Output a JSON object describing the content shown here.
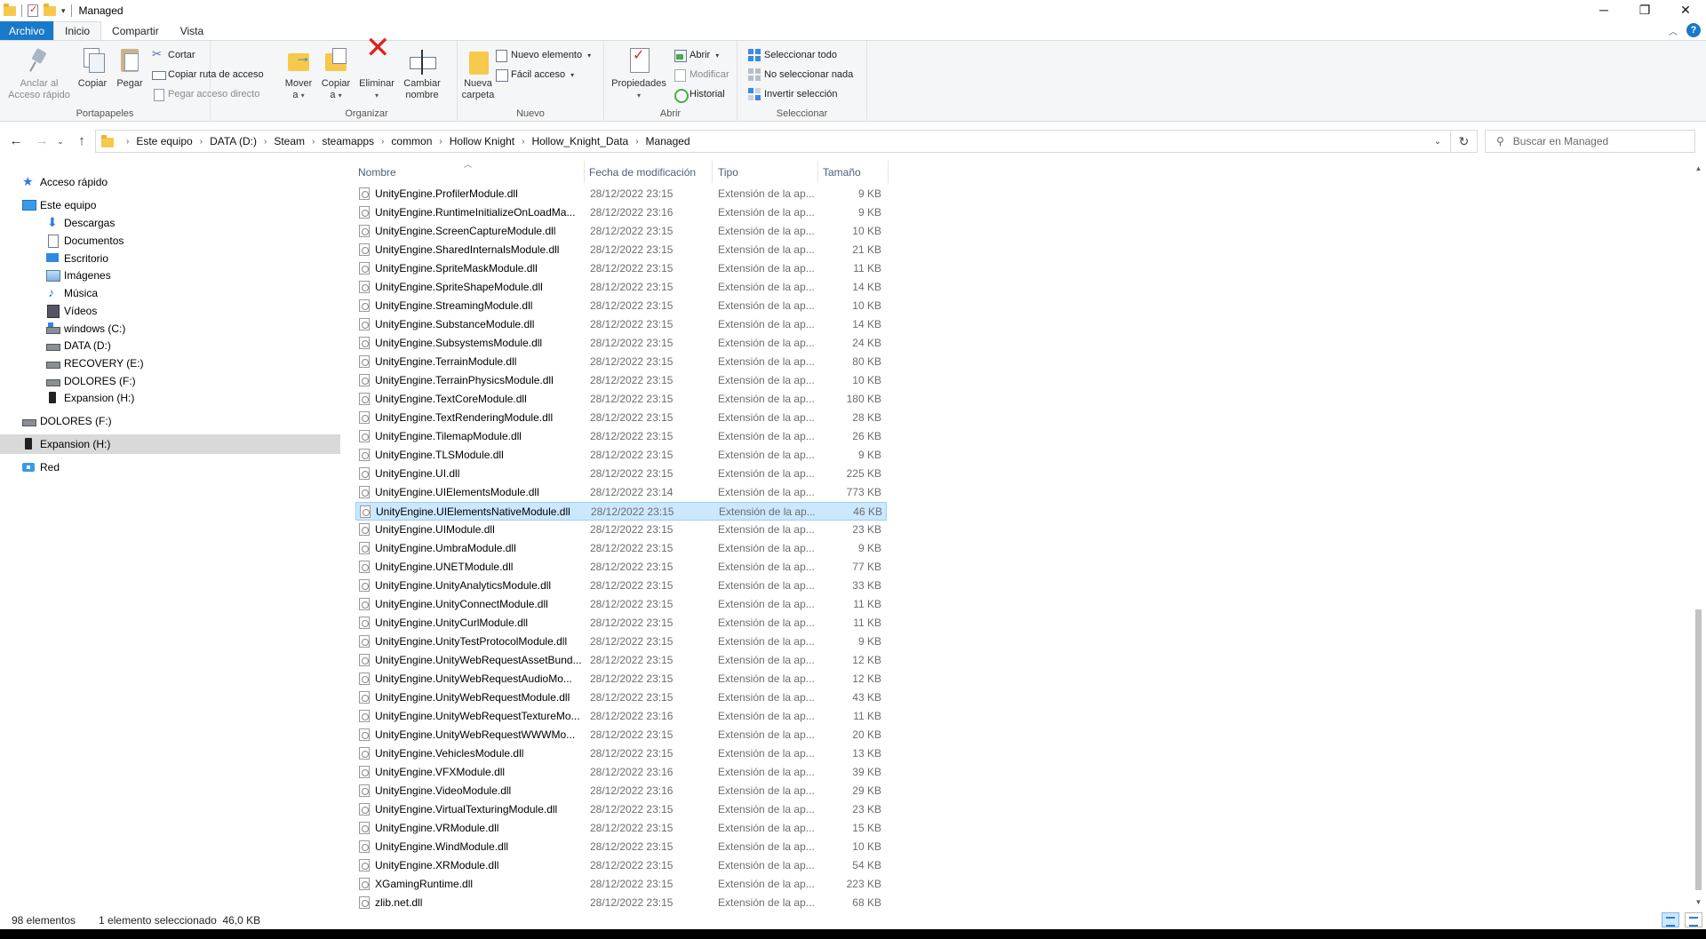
{
  "window": {
    "title": "Managed",
    "minimize_icon": "minimize-icon",
    "maximize_icon": "restore-icon",
    "close_icon": "close-icon"
  },
  "ribbon_tabs": {
    "file": "Archivo",
    "home": "Inicio",
    "share": "Compartir",
    "view": "Vista"
  },
  "ribbon": {
    "clipboard": {
      "label": "Portapapeles",
      "pin": "Anclar al Acceso rápido",
      "pin_l1": "Anclar al",
      "pin_l2": "Acceso rápido",
      "copy": "Copiar",
      "paste": "Pegar",
      "cut": "Cortar",
      "copy_path": "Copiar ruta de acceso",
      "paste_shortcut": "Pegar acceso directo"
    },
    "organize": {
      "label": "Organizar",
      "move_l1": "Mover",
      "move_l2": "a",
      "copy_l1": "Copiar",
      "copy_l2": "a",
      "delete": "Eliminar",
      "rename_l1": "Cambiar",
      "rename_l2": "nombre"
    },
    "new": {
      "label": "Nuevo",
      "folder_l1": "Nueva",
      "folder_l2": "carpeta",
      "new_item": "Nuevo elemento",
      "easy_access": "Fácil acceso"
    },
    "open": {
      "label": "Abrir",
      "properties": "Propiedades",
      "open": "Abrir",
      "edit": "Modificar",
      "history": "Historial"
    },
    "select": {
      "label": "Seleccionar",
      "select_all": "Seleccionar todo",
      "select_none": "No seleccionar nada",
      "invert": "Invertir selección"
    }
  },
  "address": {
    "breadcrumbs": [
      "Este equipo",
      "DATA (D:)",
      "Steam",
      "steamapps",
      "common",
      "Hollow Knight",
      "Hollow_Knight_Data",
      "Managed"
    ]
  },
  "search": {
    "placeholder": "Buscar en Managed"
  },
  "nav": {
    "items": [
      {
        "label": "Acceso rápido",
        "icon": "star-icon"
      },
      {
        "label": "Este equipo",
        "icon": "computer-icon"
      },
      {
        "label": "Descargas",
        "icon": "downloads-icon"
      },
      {
        "label": "Documentos",
        "icon": "documents-icon"
      },
      {
        "label": "Escritorio",
        "icon": "desktop-icon"
      },
      {
        "label": "Imágenes",
        "icon": "pictures-icon"
      },
      {
        "label": "Música",
        "icon": "music-icon"
      },
      {
        "label": "Vídeos",
        "icon": "videos-icon"
      },
      {
        "label": "windows (C:)",
        "icon": "windows-drive-icon"
      },
      {
        "label": "DATA (D:)",
        "icon": "drive-icon"
      },
      {
        "label": "RECOVERY (E:)",
        "icon": "drive-icon"
      },
      {
        "label": "DOLORES (F:)",
        "icon": "drive-icon"
      },
      {
        "label": "Expansion (H:)",
        "icon": "usb-drive-icon"
      },
      {
        "label": "DOLORES (F:)",
        "icon": "drive-icon"
      },
      {
        "label": "Expansion (H:)",
        "icon": "usb-drive-icon"
      },
      {
        "label": "Red",
        "icon": "network-icon"
      }
    ]
  },
  "columns": {
    "name": "Nombre",
    "date": "Fecha de modificación",
    "type": "Tipo",
    "size": "Tamaño"
  },
  "files": [
    {
      "name": "UnityEngine.ProfilerModule.dll",
      "date": "28/12/2022 23:15",
      "type": "Extensión de la ap...",
      "size": "9 KB"
    },
    {
      "name": "UnityEngine.RuntimeInitializeOnLoadMa...",
      "date": "28/12/2022 23:16",
      "type": "Extensión de la ap...",
      "size": "9 KB"
    },
    {
      "name": "UnityEngine.ScreenCaptureModule.dll",
      "date": "28/12/2022 23:15",
      "type": "Extensión de la ap...",
      "size": "10 KB"
    },
    {
      "name": "UnityEngine.SharedInternalsModule.dll",
      "date": "28/12/2022 23:15",
      "type": "Extensión de la ap...",
      "size": "21 KB"
    },
    {
      "name": "UnityEngine.SpriteMaskModule.dll",
      "date": "28/12/2022 23:15",
      "type": "Extensión de la ap...",
      "size": "11 KB"
    },
    {
      "name": "UnityEngine.SpriteShapeModule.dll",
      "date": "28/12/2022 23:15",
      "type": "Extensión de la ap...",
      "size": "14 KB"
    },
    {
      "name": "UnityEngine.StreamingModule.dll",
      "date": "28/12/2022 23:15",
      "type": "Extensión de la ap...",
      "size": "10 KB"
    },
    {
      "name": "UnityEngine.SubstanceModule.dll",
      "date": "28/12/2022 23:15",
      "type": "Extensión de la ap...",
      "size": "14 KB"
    },
    {
      "name": "UnityEngine.SubsystemsModule.dll",
      "date": "28/12/2022 23:15",
      "type": "Extensión de la ap...",
      "size": "24 KB"
    },
    {
      "name": "UnityEngine.TerrainModule.dll",
      "date": "28/12/2022 23:15",
      "type": "Extensión de la ap...",
      "size": "80 KB"
    },
    {
      "name": "UnityEngine.TerrainPhysicsModule.dll",
      "date": "28/12/2022 23:15",
      "type": "Extensión de la ap...",
      "size": "10 KB"
    },
    {
      "name": "UnityEngine.TextCoreModule.dll",
      "date": "28/12/2022 23:15",
      "type": "Extensión de la ap...",
      "size": "180 KB"
    },
    {
      "name": "UnityEngine.TextRenderingModule.dll",
      "date": "28/12/2022 23:15",
      "type": "Extensión de la ap...",
      "size": "28 KB"
    },
    {
      "name": "UnityEngine.TilemapModule.dll",
      "date": "28/12/2022 23:15",
      "type": "Extensión de la ap...",
      "size": "26 KB"
    },
    {
      "name": "UnityEngine.TLSModule.dll",
      "date": "28/12/2022 23:15",
      "type": "Extensión de la ap...",
      "size": "9 KB"
    },
    {
      "name": "UnityEngine.UI.dll",
      "date": "28/12/2022 23:15",
      "type": "Extensión de la ap...",
      "size": "225 KB"
    },
    {
      "name": "UnityEngine.UIElementsModule.dll",
      "date": "28/12/2022 23:14",
      "type": "Extensión de la ap...",
      "size": "773 KB"
    },
    {
      "name": "UnityEngine.UIElementsNativeModule.dll",
      "date": "28/12/2022 23:15",
      "type": "Extensión de la ap...",
      "size": "46 KB",
      "selected": true
    },
    {
      "name": "UnityEngine.UIModule.dll",
      "date": "28/12/2022 23:15",
      "type": "Extensión de la ap...",
      "size": "23 KB"
    },
    {
      "name": "UnityEngine.UmbraModule.dll",
      "date": "28/12/2022 23:15",
      "type": "Extensión de la ap...",
      "size": "9 KB"
    },
    {
      "name": "UnityEngine.UNETModule.dll",
      "date": "28/12/2022 23:15",
      "type": "Extensión de la ap...",
      "size": "77 KB"
    },
    {
      "name": "UnityEngine.UnityAnalyticsModule.dll",
      "date": "28/12/2022 23:15",
      "type": "Extensión de la ap...",
      "size": "33 KB"
    },
    {
      "name": "UnityEngine.UnityConnectModule.dll",
      "date": "28/12/2022 23:15",
      "type": "Extensión de la ap...",
      "size": "11 KB"
    },
    {
      "name": "UnityEngine.UnityCurlModule.dll",
      "date": "28/12/2022 23:15",
      "type": "Extensión de la ap...",
      "size": "11 KB"
    },
    {
      "name": "UnityEngine.UnityTestProtocolModule.dll",
      "date": "28/12/2022 23:15",
      "type": "Extensión de la ap...",
      "size": "9 KB"
    },
    {
      "name": "UnityEngine.UnityWebRequestAssetBund...",
      "date": "28/12/2022 23:15",
      "type": "Extensión de la ap...",
      "size": "12 KB"
    },
    {
      "name": "UnityEngine.UnityWebRequestAudioMo...",
      "date": "28/12/2022 23:15",
      "type": "Extensión de la ap...",
      "size": "12 KB"
    },
    {
      "name": "UnityEngine.UnityWebRequestModule.dll",
      "date": "28/12/2022 23:15",
      "type": "Extensión de la ap...",
      "size": "43 KB"
    },
    {
      "name": "UnityEngine.UnityWebRequestTextureMo...",
      "date": "28/12/2022 23:16",
      "type": "Extensión de la ap...",
      "size": "11 KB"
    },
    {
      "name": "UnityEngine.UnityWebRequestWWWMo...",
      "date": "28/12/2022 23:15",
      "type": "Extensión de la ap...",
      "size": "20 KB"
    },
    {
      "name": "UnityEngine.VehiclesModule.dll",
      "date": "28/12/2022 23:15",
      "type": "Extensión de la ap...",
      "size": "13 KB"
    },
    {
      "name": "UnityEngine.VFXModule.dll",
      "date": "28/12/2022 23:16",
      "type": "Extensión de la ap...",
      "size": "39 KB"
    },
    {
      "name": "UnityEngine.VideoModule.dll",
      "date": "28/12/2022 23:16",
      "type": "Extensión de la ap...",
      "size": "29 KB"
    },
    {
      "name": "UnityEngine.VirtualTexturingModule.dll",
      "date": "28/12/2022 23:15",
      "type": "Extensión de la ap...",
      "size": "23 KB"
    },
    {
      "name": "UnityEngine.VRModule.dll",
      "date": "28/12/2022 23:15",
      "type": "Extensión de la ap...",
      "size": "15 KB"
    },
    {
      "name": "UnityEngine.WindModule.dll",
      "date": "28/12/2022 23:15",
      "type": "Extensión de la ap...",
      "size": "10 KB"
    },
    {
      "name": "UnityEngine.XRModule.dll",
      "date": "28/12/2022 23:15",
      "type": "Extensión de la ap...",
      "size": "54 KB"
    },
    {
      "name": "XGamingRuntime.dll",
      "date": "28/12/2022 23:15",
      "type": "Extensión de la ap...",
      "size": "223 KB"
    },
    {
      "name": "zlib.net.dll",
      "date": "28/12/2022 23:15",
      "type": "Extensión de la ap...",
      "size": "68 KB"
    }
  ],
  "status": {
    "count": "98 elementos",
    "selection": "1 elemento seleccionado  46,0 KB"
  },
  "colors": {
    "accent": "#1979ca",
    "selection_bg": "#cce8ff",
    "selection_border": "#99d1ff"
  }
}
